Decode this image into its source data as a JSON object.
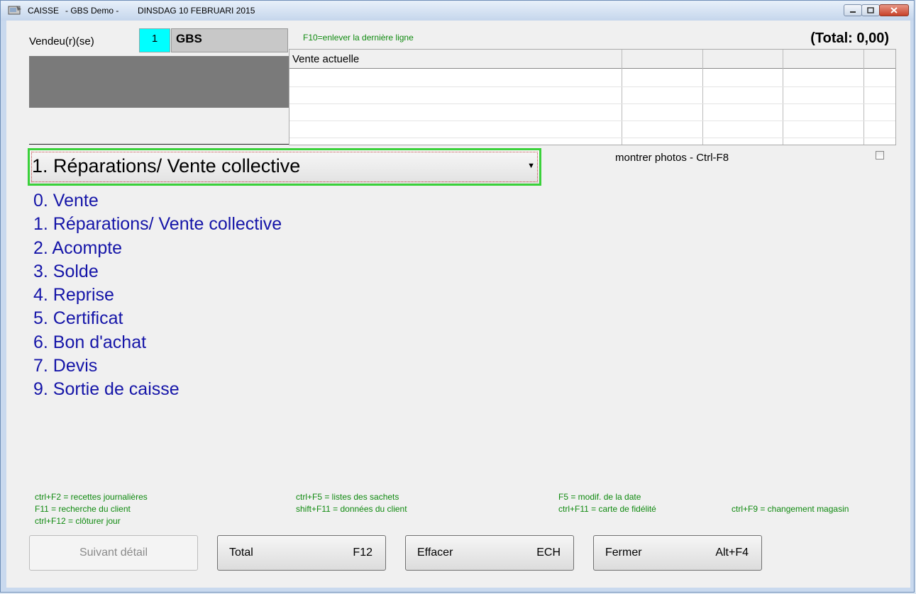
{
  "window": {
    "title_app": "CAISSE",
    "title_company": "- GBS Demo -",
    "title_date": "DINSDAG 10 FEBRUARI 2015"
  },
  "seller": {
    "label": "Vendeu(r)(se)",
    "number": "1",
    "name": "GBS"
  },
  "hint_f10": "F10=enlever la dernière ligne",
  "total": "(Total: 0,00)",
  "sale_grid": {
    "header": "Vente actuelle"
  },
  "category_select": {
    "selected": "1. Réparations/ Vente collective"
  },
  "photos_toggle": {
    "label": "montrer photos - Ctrl-F8",
    "checked": false
  },
  "menu_items": [
    "0. Vente",
    "1. Réparations/ Vente collective",
    "2. Acompte",
    "3. Solde",
    "4. Reprise",
    "5. Certificat",
    "6. Bon d'achat",
    "7. Devis",
    "9. Sortie de caisse"
  ],
  "shortcuts": {
    "ctrl_f2": "ctrl+F2 = recettes journalières",
    "f11": "F11 = recherche du client",
    "ctrl_f12": "ctrl+F12 = clôturer jour",
    "ctrl_f5": "ctrl+F5 = listes des sachets",
    "shift_f11": "shift+F11 = données du client",
    "f5": "F5 = modif. de la date",
    "ctrl_f11": "ctrl+F11 = carte de fidélité",
    "ctrl_f9": "ctrl+F9 = changement magasin"
  },
  "buttons": {
    "next_detail": "Suivant détail",
    "total_label": "Total",
    "total_key": "F12",
    "clear_label": "Effacer",
    "clear_key": "ECH",
    "close_label": "Fermer",
    "close_key": "Alt+F4"
  },
  "colors": {
    "accent_cyan": "#00ffff",
    "menu_blue": "#1515a8",
    "hint_green": "#108a10",
    "focus_green": "#3ad13a"
  }
}
